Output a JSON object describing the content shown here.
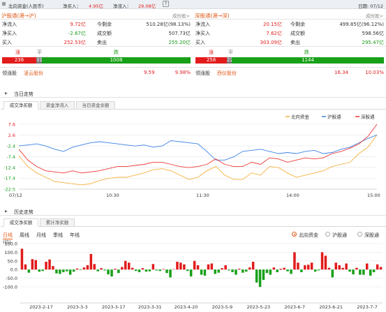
{
  "header": {
    "title": "北向资金(人民币)",
    "net_buy_label": "净买入：",
    "net_buy_value": "4.95亿",
    "net_inflow_label": "净流入：",
    "net_inflow_value": "29.08亿",
    "help": "?",
    "date": "日期: 07/12"
  },
  "panels": [
    {
      "title": "沪股通(港→沪)",
      "link": "成份股>",
      "r1": [
        "净流入",
        "9.72亿",
        "今剩余",
        "510.28亿(98.13%)"
      ],
      "r2": [
        "净买入",
        "-2.67亿",
        "成交额",
        "507.73亿"
      ],
      "r3": [
        "买入",
        "252.53亿",
        "卖出",
        "255.20亿"
      ],
      "bar_labels": [
        "涨",
        "平",
        "跌"
      ],
      "counts": [
        "236",
        "31",
        "1008"
      ],
      "lead": [
        "领涨股",
        "凌云股份",
        "9.59",
        "9.98%"
      ]
    },
    {
      "title": "深股通(港→深)",
      "link": "成份股>",
      "r1": [
        "净流入",
        "20.15亿",
        "今剩余",
        "499.85亿(96.12%)"
      ],
      "r2": [
        "净买入",
        "7.62亿",
        "成交额",
        "598.56亿"
      ],
      "r3": [
        "买入",
        "303.09亿",
        "卖出",
        "295.47亿"
      ],
      "bar_labels": [
        "涨",
        "平",
        "跌"
      ],
      "counts": [
        "258",
        "22",
        "1144"
      ],
      "lead": [
        "领涨股",
        "西仪股份",
        "16.34",
        "10.03%"
      ]
    }
  ],
  "section1": {
    "title": "当日走势",
    "tabs": [
      "成交净买额",
      "资金净流入",
      "当日资金余额"
    ]
  },
  "section2": {
    "title": "历史走势",
    "tabs": [
      "成交净买额",
      "累计净买额"
    ],
    "periods": [
      "日线",
      "周线",
      "月线",
      "季线",
      "年线"
    ],
    "options": [
      "北向资金",
      "沪股通",
      "深股通"
    ]
  },
  "colors": {
    "north": "#f5b13d",
    "sh": "#3d82e6",
    "sz": "#f03838"
  },
  "chart_data": [
    {
      "type": "line",
      "legend": [
        "北向资金",
        "沪股通",
        "深股通"
      ],
      "yticks": [
        "7.6",
        "2.6",
        "-2.4",
        "-7.4",
        "-12.4",
        "-17.4",
        "-22.5"
      ],
      "xticks": [
        "07/12",
        "10:30",
        "11:30",
        "14:00",
        "15:00"
      ],
      "ylim": [
        -22.5,
        7.6
      ],
      "x": [
        0,
        1,
        2,
        3,
        4,
        5,
        6,
        7,
        8,
        9,
        10,
        11,
        12,
        13,
        14,
        15,
        16,
        17,
        18,
        19,
        20,
        21,
        22,
        23,
        24,
        25,
        26,
        27,
        28,
        29,
        30,
        31,
        32,
        33,
        34,
        35,
        36,
        37,
        38,
        39,
        40
      ],
      "series": [
        {
          "name": "北向资金",
          "values": [
            -7,
            -12,
            -15,
            -17,
            -19,
            -19.5,
            -20,
            -20.5,
            -20,
            -18.5,
            -17.5,
            -17,
            -17,
            -16,
            -15,
            -13.5,
            -13,
            -14,
            -16,
            -18,
            -17,
            -14,
            -12,
            -16,
            -18,
            -18,
            -15,
            -16,
            -12,
            -12.5,
            -15,
            -17,
            -16,
            -15,
            -14,
            -12,
            -11,
            -10,
            -6,
            -3,
            2.6
          ]
        },
        {
          "name": "沪股通",
          "values": [
            -2.4,
            -2,
            -1.5,
            -2.5,
            -4,
            -5,
            -3,
            -2,
            -1,
            -0.5,
            -1,
            -1.5,
            -2,
            -2.5,
            -2,
            -3,
            -2.5,
            0,
            -0.5,
            -1,
            -1.5,
            -5,
            -9,
            -9,
            -7.5,
            -5,
            -4.5,
            -4,
            -5,
            -6,
            -5.5,
            -6,
            -5,
            -4.5,
            -6,
            -5.5,
            -4,
            -3,
            -1,
            1,
            2.6
          ]
        },
        {
          "name": "深股通",
          "values": [
            -4,
            -9,
            -12,
            -14,
            -14.5,
            -15,
            -14,
            -15,
            -14.5,
            -14,
            -13,
            -12,
            -12,
            -11.5,
            -11,
            -10,
            -10,
            -11,
            -12,
            -12.5,
            -12,
            -11,
            -8.5,
            -11,
            -12,
            -12,
            -10,
            -11,
            -8,
            -8.5,
            -10,
            -9,
            -8,
            -8.5,
            -8,
            -6,
            -5,
            -3.5,
            -1.5,
            2,
            7.6
          ]
        }
      ]
    },
    {
      "type": "bar",
      "yticks": [
        "150.0",
        "100.0",
        "50.0",
        "0.0",
        "-50.0",
        "-100.0"
      ],
      "yunit": "(亿)",
      "ylim": [
        -100,
        150
      ],
      "xticks": [
        "2023-2-17",
        "2023-3-3",
        "2023-3-17",
        "2023-3-31",
        "2023-4-20",
        "2023-5-9",
        "2023-5-23",
        "2023-6-7",
        "2023-6-21",
        "2023-7-7"
      ],
      "values": [
        120,
        30,
        -18,
        60,
        55,
        -12,
        -8,
        45,
        58,
        20,
        -22,
        -25,
        -15,
        -10,
        -30,
        -12,
        6,
        -3,
        12,
        25,
        90,
        32,
        -10,
        8,
        -5,
        -28,
        -40,
        5,
        -20,
        15,
        50,
        40,
        10,
        -8,
        -15,
        8,
        -12,
        -10,
        32,
        -5,
        -8,
        3,
        -20,
        -45,
        2,
        45,
        40,
        30,
        -8,
        -40,
        50,
        25,
        -30,
        -35,
        30,
        35,
        -25,
        -18,
        8,
        25,
        -5,
        -15,
        -30,
        5,
        -18,
        -12,
        12,
        45,
        -75,
        -100,
        -60,
        -20,
        -30,
        12,
        -15,
        5,
        10,
        -10,
        -25,
        100,
        40,
        -15,
        25,
        28,
        40,
        -12,
        -5,
        100,
        80,
        10,
        -45,
        40,
        25,
        10,
        35,
        -12,
        -28,
        10,
        -30,
        -30,
        35,
        -35,
        -15,
        30,
        15
      ]
    }
  ]
}
